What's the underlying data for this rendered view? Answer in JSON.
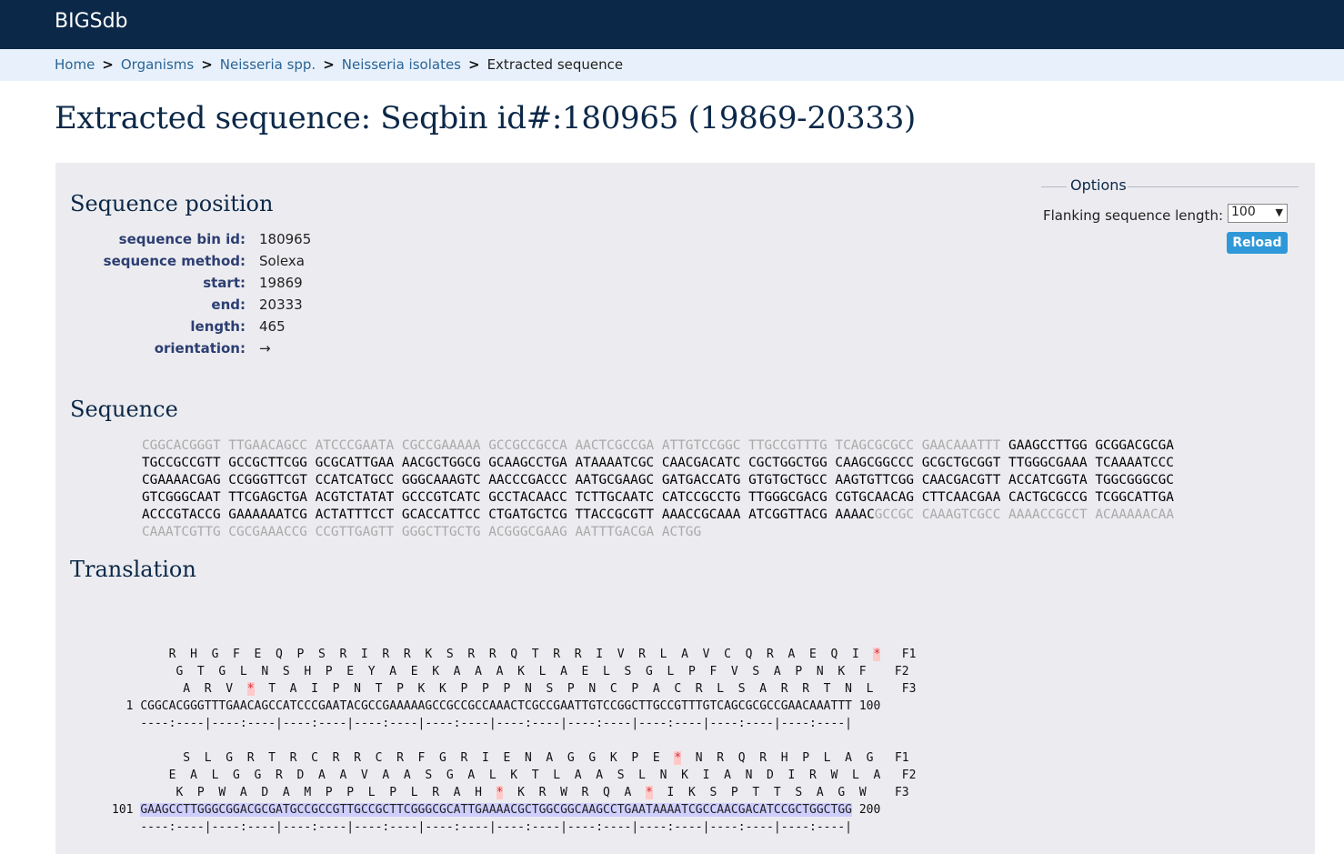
{
  "app": {
    "brand": "BIGSdb"
  },
  "breadcrumb": [
    {
      "label": "Home",
      "link": true
    },
    {
      "label": "Organisms",
      "link": true
    },
    {
      "label": "Neisseria spp.",
      "link": true
    },
    {
      "label": "Neisseria isolates",
      "link": true
    },
    {
      "label": "Extracted sequence",
      "link": false
    }
  ],
  "breadcrumb_separator": ">",
  "page_title": "Extracted sequence: Seqbin id#:180965 (19869-20333)",
  "sequence_position": {
    "heading": "Sequence position",
    "fields": [
      {
        "key": "sequence bin id:",
        "value": "180965"
      },
      {
        "key": "sequence method:",
        "value": "Solexa"
      },
      {
        "key": "start:",
        "value": "19869"
      },
      {
        "key": "end:",
        "value": "20333"
      },
      {
        "key": "length:",
        "value": "465"
      },
      {
        "key": "orientation:",
        "value": "→"
      }
    ]
  },
  "options": {
    "legend": "Options",
    "flank_label": "Flanking sequence length:",
    "flank_value": "100",
    "reload_label": "Reload"
  },
  "sequence": {
    "heading": "Sequence",
    "lines": [
      [
        {
          "t": "CGGCACGGGT TTGAACAGCC ATCCCGAATA CGCCGAAAAA GCCGCCGCCA AACTCGCCGA ATTGTCCGGC TTGCCGTTTG TCAGCGCGCC GAACAAATTT ",
          "f": true
        },
        {
          "t": "GAAGCCTTGG GCGGACGCGA",
          "f": false
        }
      ],
      [
        {
          "t": "TGCCGCCGTT GCCGCTTCGG GCGCATTGAA AACGCTGGCG GCAAGCCTGA ATAAAATCGC CAACGACATC CGCTGGCTGG CAAGCGGCCC GCGCTGCGGT TTGGGCGAAA TCAAAATCCC",
          "f": false
        }
      ],
      [
        {
          "t": "CGAAAACGAG CCGGGTTCGT CCATCATGCC GGGCAAAGTC AACCCGACCC AATGCGAAGC GATGACCATG GTGTGCTGCC AAGTGTTCGG CAACGACGTT ACCATCGGTA TGGCGGGCGC",
          "f": false
        }
      ],
      [
        {
          "t": "GTCGGGCAAT TTCGAGCTGA ACGTCTATAT GCCCGTCATC GCCTACAACC TCTTGCAATC CATCCGCCTG TTGGGCGACG CGTGCAACAG CTTCAACGAA CACTGCGCCG TCGGCATTGA",
          "f": false
        }
      ],
      [
        {
          "t": "ACCCGTACCG GAAAAAATCG ACTATTTCCT GCACCATTCC CTGATGCTCG TTACCGCGTT AAACCGCAAA ATCGGTTACG AAAAC",
          "f": false
        },
        {
          "t": "GCCGC CAAAGTCGCC AAAACCGCCT ACAAAAACAA",
          "f": true
        }
      ],
      [
        {
          "t": "CAAATCGTTG CGCGAAACCG CCGTTGAGTT GGGCTTGCTG ACGGGCGAAG AATTTGACGA ACTGG",
          "f": true
        }
      ]
    ]
  },
  "translation": {
    "heading": "Translation",
    "blocks": [
      {
        "frames": [
          {
            "text": " R  H  G  F  E  Q  P  S  R  I  R  R  K  S  R  R  Q  T  R  R  I  V  R  L  A  V  C  Q  R  A  E  Q  I  *   F1"
          },
          {
            "text": "  G  T  G  L  N  S  H  P  E  Y  A  E  K  A  A  A  K  L  A  E  L  S  G  L  P  F  V  S  A  P  N  K  F    F2"
          },
          {
            "text": "   A  R  V  *  T  A  I  P  N  T  P  K  K  P  P  P  N  S  P  N  C  P  A  C  R  L  S  A  R  R  T  N  L    F3"
          }
        ],
        "start": "1",
        "seq_plain": "CGGCACGGGTTTGAACAGCCATCCCGAATACGCCGAAAAAGCCGCCGCCAAACTCGCCGAATTGTCCGGCTTGCCGTTTGTCAGCGCGCCGAACAAATTT",
        "seq_hl": "",
        "end": "100",
        "ruler": "----:----|----:----|----:----|----:----|----:----|----:----|----:----|----:----|----:----|----:----|"
      },
      {
        "frames": [
          {
            "text": "   S  L  G  R  T  R  C  R  R  C  R  F  G  R  I  E  N  A  G  G  K  P  E  *  N  R  Q  R  H  P  L  A  G   F1"
          },
          {
            "text": " E  A  L  G  G  R  D  A  A  V  A  A  S  G  A  L  K  T  L  A  A  S  L  N  K  I  A  N  D  I  R  W  L  A   F2"
          },
          {
            "text": "  K  P  W  A  D  A  M  P  P  L  P  L  R  A  H  *  K  R  W  R  Q  A  *  I  K  S  P  T  T  S  A  G  W    F3"
          }
        ],
        "start": "101",
        "seq_plain": "",
        "seq_hl": "GAAGCCTTGGGCGGACGCGATGCCGCCGTTGCCGCTTCGGGCGCATTGAAAACGCTGGCGGCAAGCCTGAATAAAATCGCCAACGACATCCGCTGGCTGG",
        "end": "200",
        "ruler": "----:----|----:----|----:----|----:----|----:----|----:----|----:----|----:----|----:----|----:----|"
      }
    ]
  }
}
